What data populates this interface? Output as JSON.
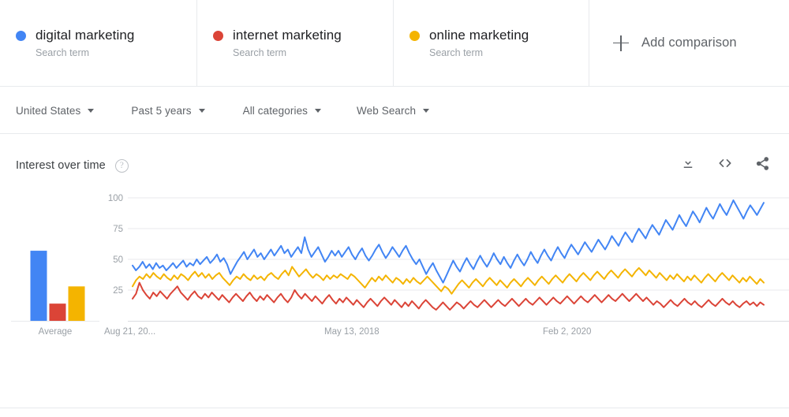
{
  "colors": {
    "blue": "#4285F4",
    "red": "#DB4437",
    "yellow": "#F4B400",
    "grid": "#e8eaed",
    "axis_text": "#9aa0a6",
    "text": "#202124",
    "muted": "#5f6368"
  },
  "terms": [
    {
      "name": "digital marketing",
      "type": "Search term",
      "color": "#4285F4",
      "dot": "blue-dot"
    },
    {
      "name": "internet marketing",
      "type": "Search term",
      "color": "#DB4437",
      "dot": "red-dot"
    },
    {
      "name": "online marketing",
      "type": "Search term",
      "color": "#F4B400",
      "dot": "yellow-dot"
    }
  ],
  "add_comparison": {
    "label": "Add comparison",
    "icon": "plus-icon"
  },
  "filters": [
    {
      "label": "United States",
      "name": "region"
    },
    {
      "label": "Past 5 years",
      "name": "time-range"
    },
    {
      "label": "All categories",
      "name": "category"
    },
    {
      "label": "Web Search",
      "name": "search-type"
    }
  ],
  "interest_over_time": {
    "title": "Interest over time",
    "help_glyph": "?",
    "actions": [
      {
        "name": "download-csv-button",
        "icon": "download-icon"
      },
      {
        "name": "embed-button",
        "icon": "code-embed-icon"
      },
      {
        "name": "share-button",
        "icon": "share-icon"
      }
    ]
  },
  "chart_data": {
    "type": "line",
    "title": "Interest over time",
    "xlabel": "",
    "ylabel": "",
    "ylim": [
      0,
      100
    ],
    "grid": true,
    "y_ticks": [
      100,
      75,
      50,
      25
    ],
    "x_tick_labels": [
      "Aug 21, 20...",
      "May 13, 2018",
      "Feb 2, 2020"
    ],
    "x_tick_positions": [
      0.0,
      0.5,
      0.835
    ],
    "legend_position": "top",
    "average_chart": {
      "type": "bar",
      "category_label": "Average",
      "categories": [
        "digital marketing",
        "internet marketing",
        "online marketing"
      ],
      "values": [
        57,
        14,
        28
      ],
      "colors": [
        "#4285F4",
        "#DB4437",
        "#F4B400"
      ]
    },
    "series": [
      {
        "name": "digital marketing",
        "color": "#4285F4",
        "values": [
          45,
          41,
          44,
          48,
          43,
          46,
          42,
          47,
          43,
          45,
          41,
          44,
          47,
          43,
          46,
          49,
          44,
          47,
          45,
          50,
          46,
          49,
          52,
          47,
          50,
          54,
          48,
          51,
          46,
          38,
          43,
          48,
          52,
          56,
          50,
          54,
          58,
          52,
          55,
          50,
          54,
          58,
          53,
          57,
          61,
          55,
          58,
          52,
          56,
          60,
          55,
          68,
          58,
          52,
          56,
          60,
          54,
          48,
          52,
          57,
          53,
          57,
          52,
          56,
          60,
          54,
          50,
          55,
          59,
          53,
          49,
          53,
          58,
          62,
          56,
          51,
          55,
          60,
          56,
          52,
          57,
          61,
          55,
          50,
          46,
          50,
          44,
          38,
          43,
          47,
          41,
          36,
          31,
          37,
          43,
          49,
          44,
          40,
          46,
          51,
          46,
          42,
          48,
          53,
          48,
          44,
          49,
          55,
          50,
          46,
          52,
          47,
          43,
          49,
          54,
          49,
          45,
          50,
          56,
          51,
          47,
          53,
          58,
          53,
          49,
          55,
          60,
          55,
          51,
          57,
          62,
          58,
          54,
          59,
          64,
          60,
          56,
          61,
          66,
          62,
          58,
          63,
          69,
          65,
          61,
          67,
          72,
          68,
          64,
          70,
          75,
          71,
          67,
          73,
          78,
          74,
          70,
          76,
          82,
          78,
          74,
          80,
          86,
          81,
          77,
          83,
          89,
          85,
          80,
          86,
          92,
          87,
          83,
          89,
          95,
          90,
          86,
          92,
          98,
          93,
          88,
          83,
          89,
          94,
          90,
          86,
          91,
          96
        ]
      },
      {
        "name": "online marketing",
        "color": "#F4B400",
        "values": [
          28,
          33,
          36,
          34,
          38,
          35,
          39,
          36,
          34,
          38,
          35,
          33,
          37,
          34,
          38,
          36,
          33,
          37,
          40,
          36,
          39,
          35,
          38,
          34,
          37,
          39,
          35,
          32,
          29,
          33,
          36,
          34,
          38,
          35,
          33,
          37,
          34,
          36,
          33,
          37,
          39,
          36,
          34,
          38,
          41,
          37,
          44,
          40,
          36,
          39,
          42,
          38,
          35,
          38,
          36,
          33,
          37,
          34,
          37,
          35,
          38,
          36,
          34,
          38,
          36,
          33,
          30,
          27,
          31,
          35,
          32,
          36,
          33,
          37,
          34,
          31,
          35,
          33,
          30,
          34,
          31,
          35,
          32,
          30,
          33,
          36,
          33,
          30,
          27,
          24,
          28,
          26,
          22,
          26,
          30,
          33,
          30,
          27,
          31,
          34,
          31,
          28,
          32,
          35,
          32,
          29,
          33,
          30,
          27,
          31,
          34,
          31,
          28,
          32,
          35,
          32,
          29,
          33,
          36,
          33,
          30,
          34,
          37,
          34,
          31,
          35,
          38,
          35,
          32,
          36,
          39,
          36,
          33,
          37,
          40,
          37,
          34,
          38,
          41,
          38,
          35,
          39,
          42,
          39,
          36,
          40,
          43,
          40,
          37,
          41,
          38,
          35,
          39,
          36,
          33,
          37,
          34,
          38,
          35,
          32,
          36,
          33,
          37,
          34,
          31,
          35,
          38,
          35,
          32,
          36,
          39,
          36,
          33,
          37,
          34,
          31,
          35,
          32,
          36,
          33,
          30,
          34,
          31
        ]
      },
      {
        "name": "internet marketing",
        "color": "#DB4437",
        "values": [
          18,
          22,
          31,
          25,
          21,
          18,
          23,
          20,
          24,
          21,
          18,
          22,
          25,
          28,
          23,
          20,
          17,
          21,
          24,
          20,
          18,
          22,
          19,
          23,
          20,
          17,
          21,
          18,
          15,
          19,
          22,
          19,
          16,
          20,
          23,
          19,
          16,
          20,
          17,
          21,
          18,
          15,
          19,
          22,
          18,
          15,
          19,
          25,
          21,
          18,
          22,
          19,
          16,
          20,
          17,
          14,
          18,
          21,
          17,
          14,
          18,
          15,
          19,
          16,
          13,
          17,
          14,
          11,
          15,
          18,
          15,
          12,
          16,
          19,
          16,
          13,
          17,
          14,
          11,
          15,
          12,
          16,
          13,
          10,
          14,
          17,
          14,
          11,
          9,
          12,
          15,
          12,
          9,
          12,
          15,
          13,
          10,
          13,
          16,
          13,
          11,
          14,
          17,
          14,
          11,
          14,
          17,
          14,
          12,
          15,
          18,
          15,
          12,
          15,
          18,
          15,
          13,
          16,
          19,
          16,
          13,
          16,
          19,
          16,
          14,
          17,
          20,
          17,
          14,
          17,
          20,
          17,
          15,
          18,
          21,
          18,
          15,
          18,
          21,
          18,
          16,
          19,
          22,
          19,
          16,
          19,
          22,
          19,
          16,
          19,
          16,
          13,
          16,
          14,
          11,
          14,
          17,
          14,
          12,
          15,
          18,
          15,
          13,
          16,
          13,
          11,
          14,
          17,
          14,
          12,
          15,
          18,
          15,
          13,
          16,
          13,
          11,
          14,
          16,
          13,
          15,
          12,
          15,
          13
        ]
      }
    ]
  }
}
